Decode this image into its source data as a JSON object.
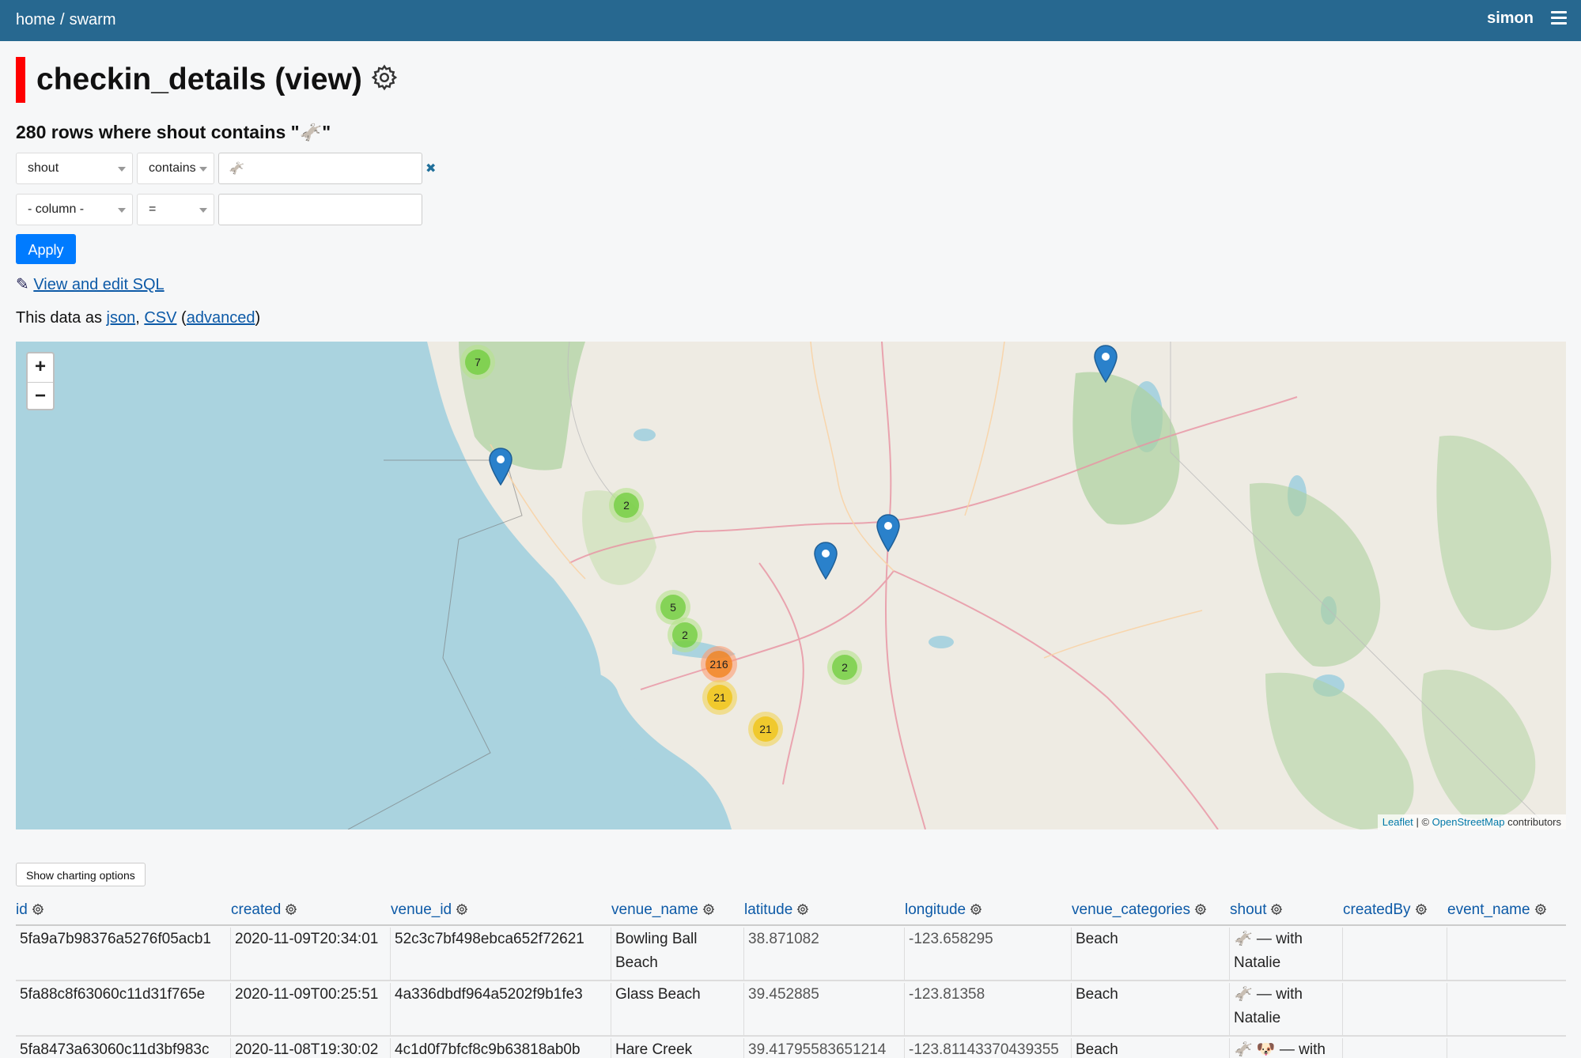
{
  "nav": {
    "home": "home",
    "separator": "/",
    "current": "swarm",
    "user": "simon"
  },
  "page": {
    "title": "checkin_details (view)"
  },
  "filter": {
    "summary": "280 rows where shout contains \"🫏\"",
    "row1": {
      "column": "shout",
      "op": "contains",
      "value": "🫏"
    },
    "row2": {
      "column": "- column -",
      "op": "=",
      "value": ""
    },
    "apply_label": "Apply"
  },
  "links": {
    "sql_icon": "✎",
    "sql_label": "View and edit SQL",
    "data_as_prefix": "This data as",
    "json": "json",
    "comma": ",",
    "csv": "CSV",
    "advanced": "advanced",
    "open_paren": "(",
    "close_paren": ")"
  },
  "map": {
    "zoom_in": "+",
    "zoom_out": "−",
    "clusters": [
      {
        "count": "7",
        "color": "green"
      },
      {
        "count": "2",
        "color": "green"
      },
      {
        "count": "5",
        "color": "green"
      },
      {
        "count": "2",
        "color": "green"
      },
      {
        "count": "216",
        "color": "orange"
      },
      {
        "count": "21",
        "color": "yellow"
      },
      {
        "count": "21",
        "color": "yellow"
      },
      {
        "count": "2",
        "color": "green"
      }
    ],
    "attribution": {
      "leaflet": "Leaflet",
      "sep": "|",
      "copy": "©",
      "osm": "OpenStreetMap",
      "suffix": "contributors"
    }
  },
  "chart_button": "Show charting options",
  "table": {
    "columns": [
      "id",
      "created",
      "venue_id",
      "venue_name",
      "latitude",
      "longitude",
      "venue_categories",
      "shout",
      "createdBy",
      "event_name"
    ],
    "rows": [
      [
        "5fa9a7b98376a5276f05acb1",
        "2020-11-09T20:34:01",
        "52c3c7bf498ebca652f72621",
        "Bowling Ball Beach",
        "38.871082",
        "-123.658295",
        "Beach",
        "🫏 — with Natalie",
        "",
        ""
      ],
      [
        "5fa88c8f63060c11d31f765e",
        "2020-11-09T00:25:51",
        "4a336dbdf964a5202f9b1fe3",
        "Glass Beach",
        "39.452885",
        "-123.81358",
        "Beach",
        "🫏 — with Natalie",
        "",
        ""
      ],
      [
        "5fa8473a63060c11d3bf983c",
        "2020-11-08T19:30:02",
        "4c1d0f7bfcf8c9b63818ab0b",
        "Hare Creek",
        "39.41795583651214",
        "-123.81143370439355",
        "Beach",
        "🫏 🐶 — with",
        "",
        ""
      ]
    ]
  },
  "colors": {
    "nav_bg": "#276890",
    "title_bar": "#ff0000",
    "link": "#0d5aa7",
    "apply": "#007bff",
    "water": "#aad3df"
  }
}
